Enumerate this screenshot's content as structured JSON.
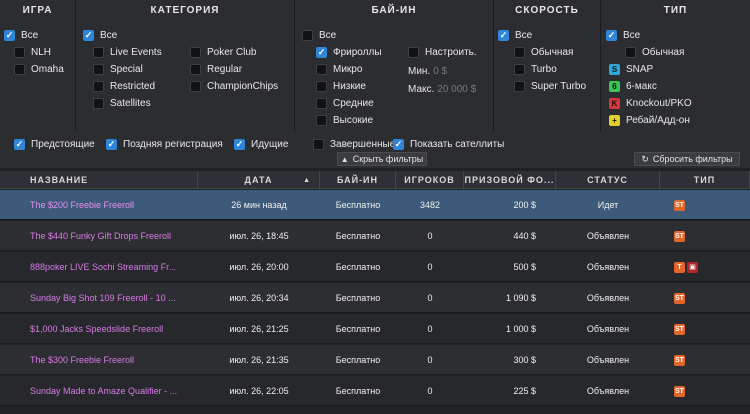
{
  "filters": {
    "game": {
      "header": "ИГРА",
      "options": [
        {
          "label": "Все",
          "checked": true
        },
        {
          "label": "NLH",
          "checked": false
        },
        {
          "label": "Omaha",
          "checked": false
        }
      ]
    },
    "category": {
      "header": "КАТЕГОРИЯ",
      "all": {
        "label": "Все",
        "checked": true
      },
      "left": [
        {
          "label": "Live Events",
          "checked": false
        },
        {
          "label": "Special",
          "checked": false
        },
        {
          "label": "Restricted",
          "checked": false
        },
        {
          "label": "Satellites",
          "checked": false
        }
      ],
      "right": [
        {
          "label": "Poker Club",
          "checked": false
        },
        {
          "label": "Regular",
          "checked": false
        },
        {
          "label": "ChampionChips",
          "checked": false
        }
      ]
    },
    "buyin": {
      "header": "БАЙ-ИН",
      "options": [
        {
          "label": "Все",
          "checked": false
        },
        {
          "label": "Фрироллы",
          "checked": true
        },
        {
          "label": "Микро",
          "checked": false
        },
        {
          "label": "Низкие",
          "checked": false
        },
        {
          "label": "Средние",
          "checked": false
        },
        {
          "label": "Высокие",
          "checked": false
        }
      ],
      "custom": {
        "label": "Настроить.",
        "checked": false
      },
      "min": {
        "label": "Мин.",
        "value": "0 $"
      },
      "max": {
        "label": "Макс.",
        "value": "20 000 $"
      }
    },
    "speed": {
      "header": "СКОРОСТЬ",
      "options": [
        {
          "label": "Все",
          "checked": true
        },
        {
          "label": "Обычная",
          "checked": false
        },
        {
          "label": "Turbo",
          "checked": false
        },
        {
          "label": "Super Turbo",
          "checked": false
        }
      ]
    },
    "type": {
      "header": "ТИП",
      "options": [
        {
          "label": "Все",
          "checked": true,
          "icon": ""
        },
        {
          "label": "Обычная",
          "checked": false,
          "icon": ""
        },
        {
          "label": "SNAP",
          "checked": false,
          "icon": "snap-icon",
          "color": "#2ea7d8",
          "glyph": "S"
        },
        {
          "label": "6-макс",
          "checked": false,
          "icon": "six-max-icon",
          "color": "#3cc356",
          "glyph": "6"
        },
        {
          "label": "Knockout/PKO",
          "checked": false,
          "icon": "knockout-icon",
          "color": "#d9363c",
          "glyph": "K"
        },
        {
          "label": "Ребай/Адд-он",
          "checked": false,
          "icon": "rebuy-icon",
          "color": "#e2cf2a",
          "glyph": "+"
        }
      ]
    },
    "bottom": [
      {
        "label": "Предстоящие",
        "checked": true
      },
      {
        "label": "Поздняя регистрация",
        "checked": true
      },
      {
        "label": "Идущие",
        "checked": true
      },
      {
        "label": "Завершенные",
        "checked": false
      },
      {
        "label": "Показать сателлиты",
        "checked": true
      }
    ],
    "hide_label": "Скрыть фильтры",
    "reset_label": "Сбросить фильтры"
  },
  "table": {
    "columns": [
      "НАЗВАНИЕ",
      "ДАТА",
      "БАЙ-ИН",
      "ИГРОКОВ",
      "ПРИЗОВОЙ ФО...",
      "СТАТУС",
      "ТИП"
    ],
    "rows": [
      {
        "name": "The $200 Freebie Freeroll",
        "date": "26 мин назад",
        "buyin": "Бесплатно",
        "players": "3482",
        "prize": "200 $",
        "status": "Идет",
        "badges": [
          "ST"
        ],
        "selected": true
      },
      {
        "name": "The $440 Funky Gift Drops Freeroll",
        "date": "июл. 26, 18:45",
        "buyin": "Бесплатно",
        "players": "0",
        "prize": "440 $",
        "status": "Объявлен",
        "badges": [
          "ST"
        ]
      },
      {
        "name": "888poker LIVE Sochi Streaming Fr...",
        "date": "июл. 26, 20:00",
        "buyin": "Бесплатно",
        "players": "0",
        "prize": "500 $",
        "status": "Объявлен",
        "badges": [
          "T"
        ],
        "locked": true
      },
      {
        "name": "Sunday Big Shot 109 Freeroll - 10 ...",
        "date": "июл. 26, 20:34",
        "buyin": "Бесплатно",
        "players": "0",
        "prize": "1 090 $",
        "status": "Объявлен",
        "badges": [
          "ST"
        ]
      },
      {
        "name": "$1,000 Jacks Speedslide Freeroll",
        "date": "июл. 26, 21:25",
        "buyin": "Бесплатно",
        "players": "0",
        "prize": "1 000 $",
        "status": "Объявлен",
        "badges": [
          "ST"
        ]
      },
      {
        "name": "The $300 Freebie Freeroll",
        "date": "июл. 26, 21:35",
        "buyin": "Бесплатно",
        "players": "0",
        "prize": "300 $",
        "status": "Объявлен",
        "badges": [
          "ST"
        ]
      },
      {
        "name": "Sunday Made to Amaze Qualifier - ...",
        "date": "июл. 26, 22:05",
        "buyin": "Бесплатно",
        "players": "0",
        "prize": "225 $",
        "status": "Объявлен",
        "badges": [
          "ST"
        ]
      }
    ]
  }
}
